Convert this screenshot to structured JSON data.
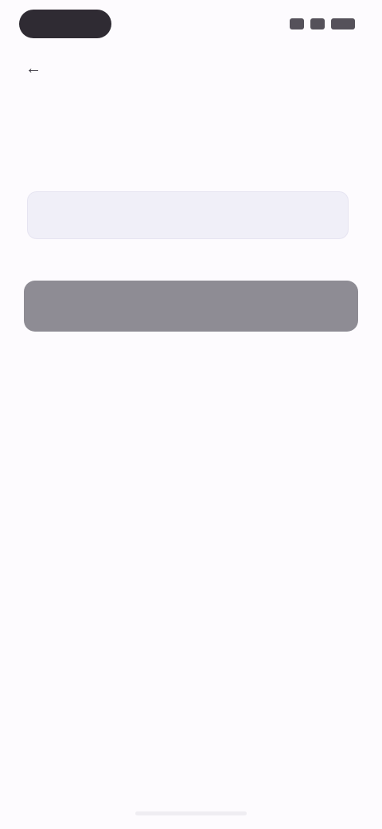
{
  "status_bar": {
    "icons": [
      "signal-icon",
      "wifi-icon",
      "battery-icon"
    ]
  },
  "header": {
    "back_icon": "back-arrow-icon"
  },
  "main": {
    "title": "",
    "subtitle": "",
    "input": {
      "value": "",
      "placeholder": ""
    },
    "primary_button_label": "",
    "helper_text": ""
  },
  "footer": {
    "links": [
      {
        "label": ""
      },
      {
        "label": ""
      }
    ]
  },
  "colors": {
    "accent": "#4b45c7",
    "button_disabled": "#8e8c94",
    "background": "#fdfbfe",
    "input_background": "#f0eff8"
  }
}
